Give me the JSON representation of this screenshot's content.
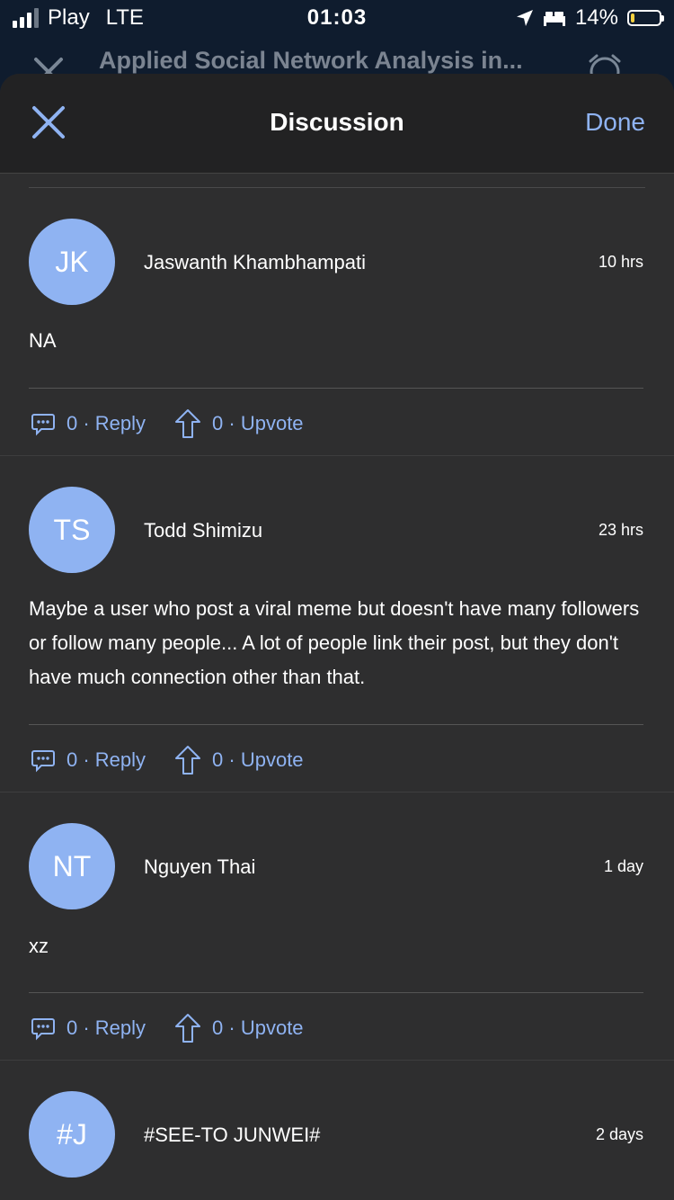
{
  "status_bar": {
    "carrier": "Play",
    "network": "LTE",
    "time": "01:03",
    "battery": "14%",
    "battery_level": 0.14
  },
  "background_header": {
    "title": "Applied Social Network Analysis in..."
  },
  "modal": {
    "title": "Discussion",
    "done_label": "Done"
  },
  "comments": [
    {
      "initials": "JK",
      "author": "Jaswanth Khambhampati",
      "time": "10 hrs",
      "text": "NA",
      "reply_label": "0 · Reply",
      "upvote_label": "0 · Upvote"
    },
    {
      "initials": "TS",
      "author": "Todd Shimizu",
      "time": "23 hrs",
      "text": "Maybe a user who post a viral meme but doesn't have many followers or follow many people...  A lot of people link their post, but they don't have much connection other than that.",
      "reply_label": "0 · Reply",
      "upvote_label": "0 · Upvote"
    },
    {
      "initials": "NT",
      "author": "Nguyen Thai",
      "time": "1 day",
      "text": "xz",
      "reply_label": "0 · Reply",
      "upvote_label": "0 · Upvote"
    },
    {
      "initials": "#J",
      "author": "#SEE-TO JUNWEI#",
      "time": "2 days"
    }
  ],
  "colors": {
    "accent": "#8fb3f2",
    "sheet_bg": "#2e2e2f",
    "header_bg": "#222223",
    "battery_fill": "#f4d03f"
  }
}
